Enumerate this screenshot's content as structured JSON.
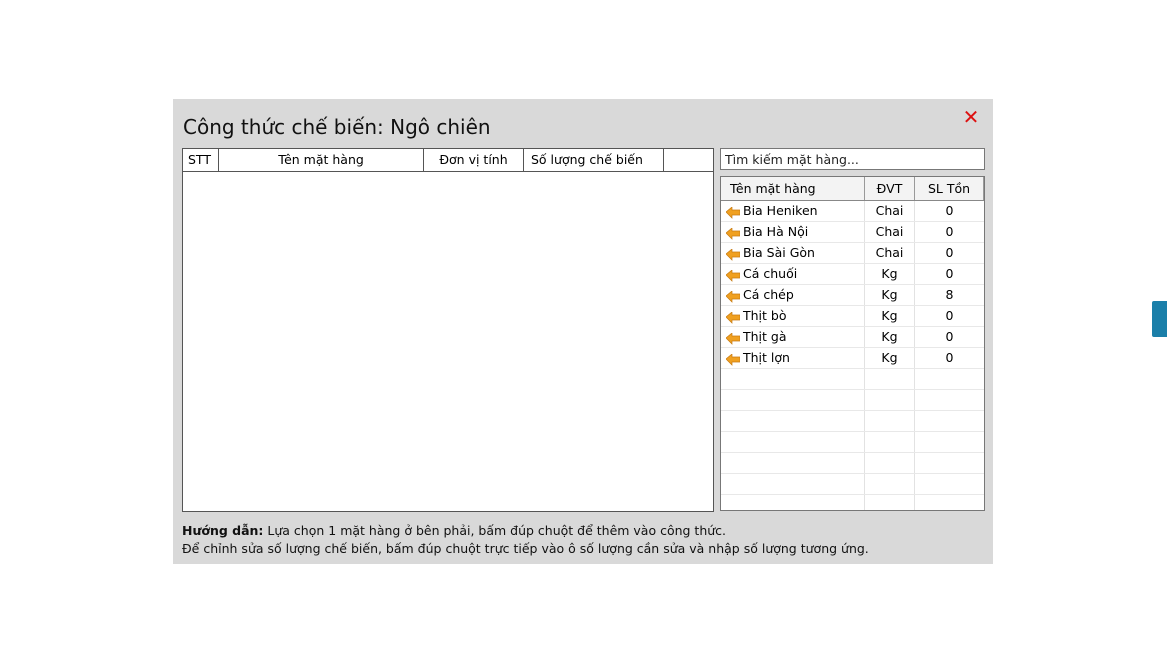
{
  "dialog": {
    "title": "Công thức chế biến: Ngô chiên",
    "close_symbol": "✕"
  },
  "recipe_table": {
    "columns": [
      "STT",
      "Tên mặt hàng",
      "Đơn vị tính",
      "Số lượng chế biến",
      ""
    ],
    "rows": []
  },
  "search": {
    "placeholder": "Tìm kiếm mặt hàng..."
  },
  "item_table": {
    "columns": [
      "Tên mặt hàng",
      "ĐVT",
      "SL Tồn"
    ],
    "row_icon": "arrow-left-icon",
    "icon_color": "#f0a020",
    "rows": [
      {
        "name": "Bia Heniken",
        "unit": "Chai",
        "stock": "0"
      },
      {
        "name": "Bia Hà Nội",
        "unit": "Chai",
        "stock": "0"
      },
      {
        "name": "Bia Sài Gòn",
        "unit": "Chai",
        "stock": "0"
      },
      {
        "name": "Cá chuối",
        "unit": "Kg",
        "stock": "0"
      },
      {
        "name": "Cá chép",
        "unit": "Kg",
        "stock": "8"
      },
      {
        "name": "Thịt bò",
        "unit": "Kg",
        "stock": "0"
      },
      {
        "name": "Thịt gà",
        "unit": "Kg",
        "stock": "0"
      },
      {
        "name": "Thịt lợn",
        "unit": "Kg",
        "stock": "0"
      }
    ],
    "empty_rows": 7
  },
  "help": {
    "label": "Hướng dẫn:",
    "line1": " Lựa chọn 1 mặt hàng ở bên phải, bấm đúp chuột để thêm vào công thức.",
    "line2": "Để chỉnh sửa số lượng chế biến, bấm đúp chuột trực tiếp vào ô số lượng cần sửa và nhập số lượng tương ứng."
  },
  "colors": {
    "dialog_bg": "#d9d9d9",
    "close": "#dd1111",
    "side_tab": "#1b7fa9"
  }
}
